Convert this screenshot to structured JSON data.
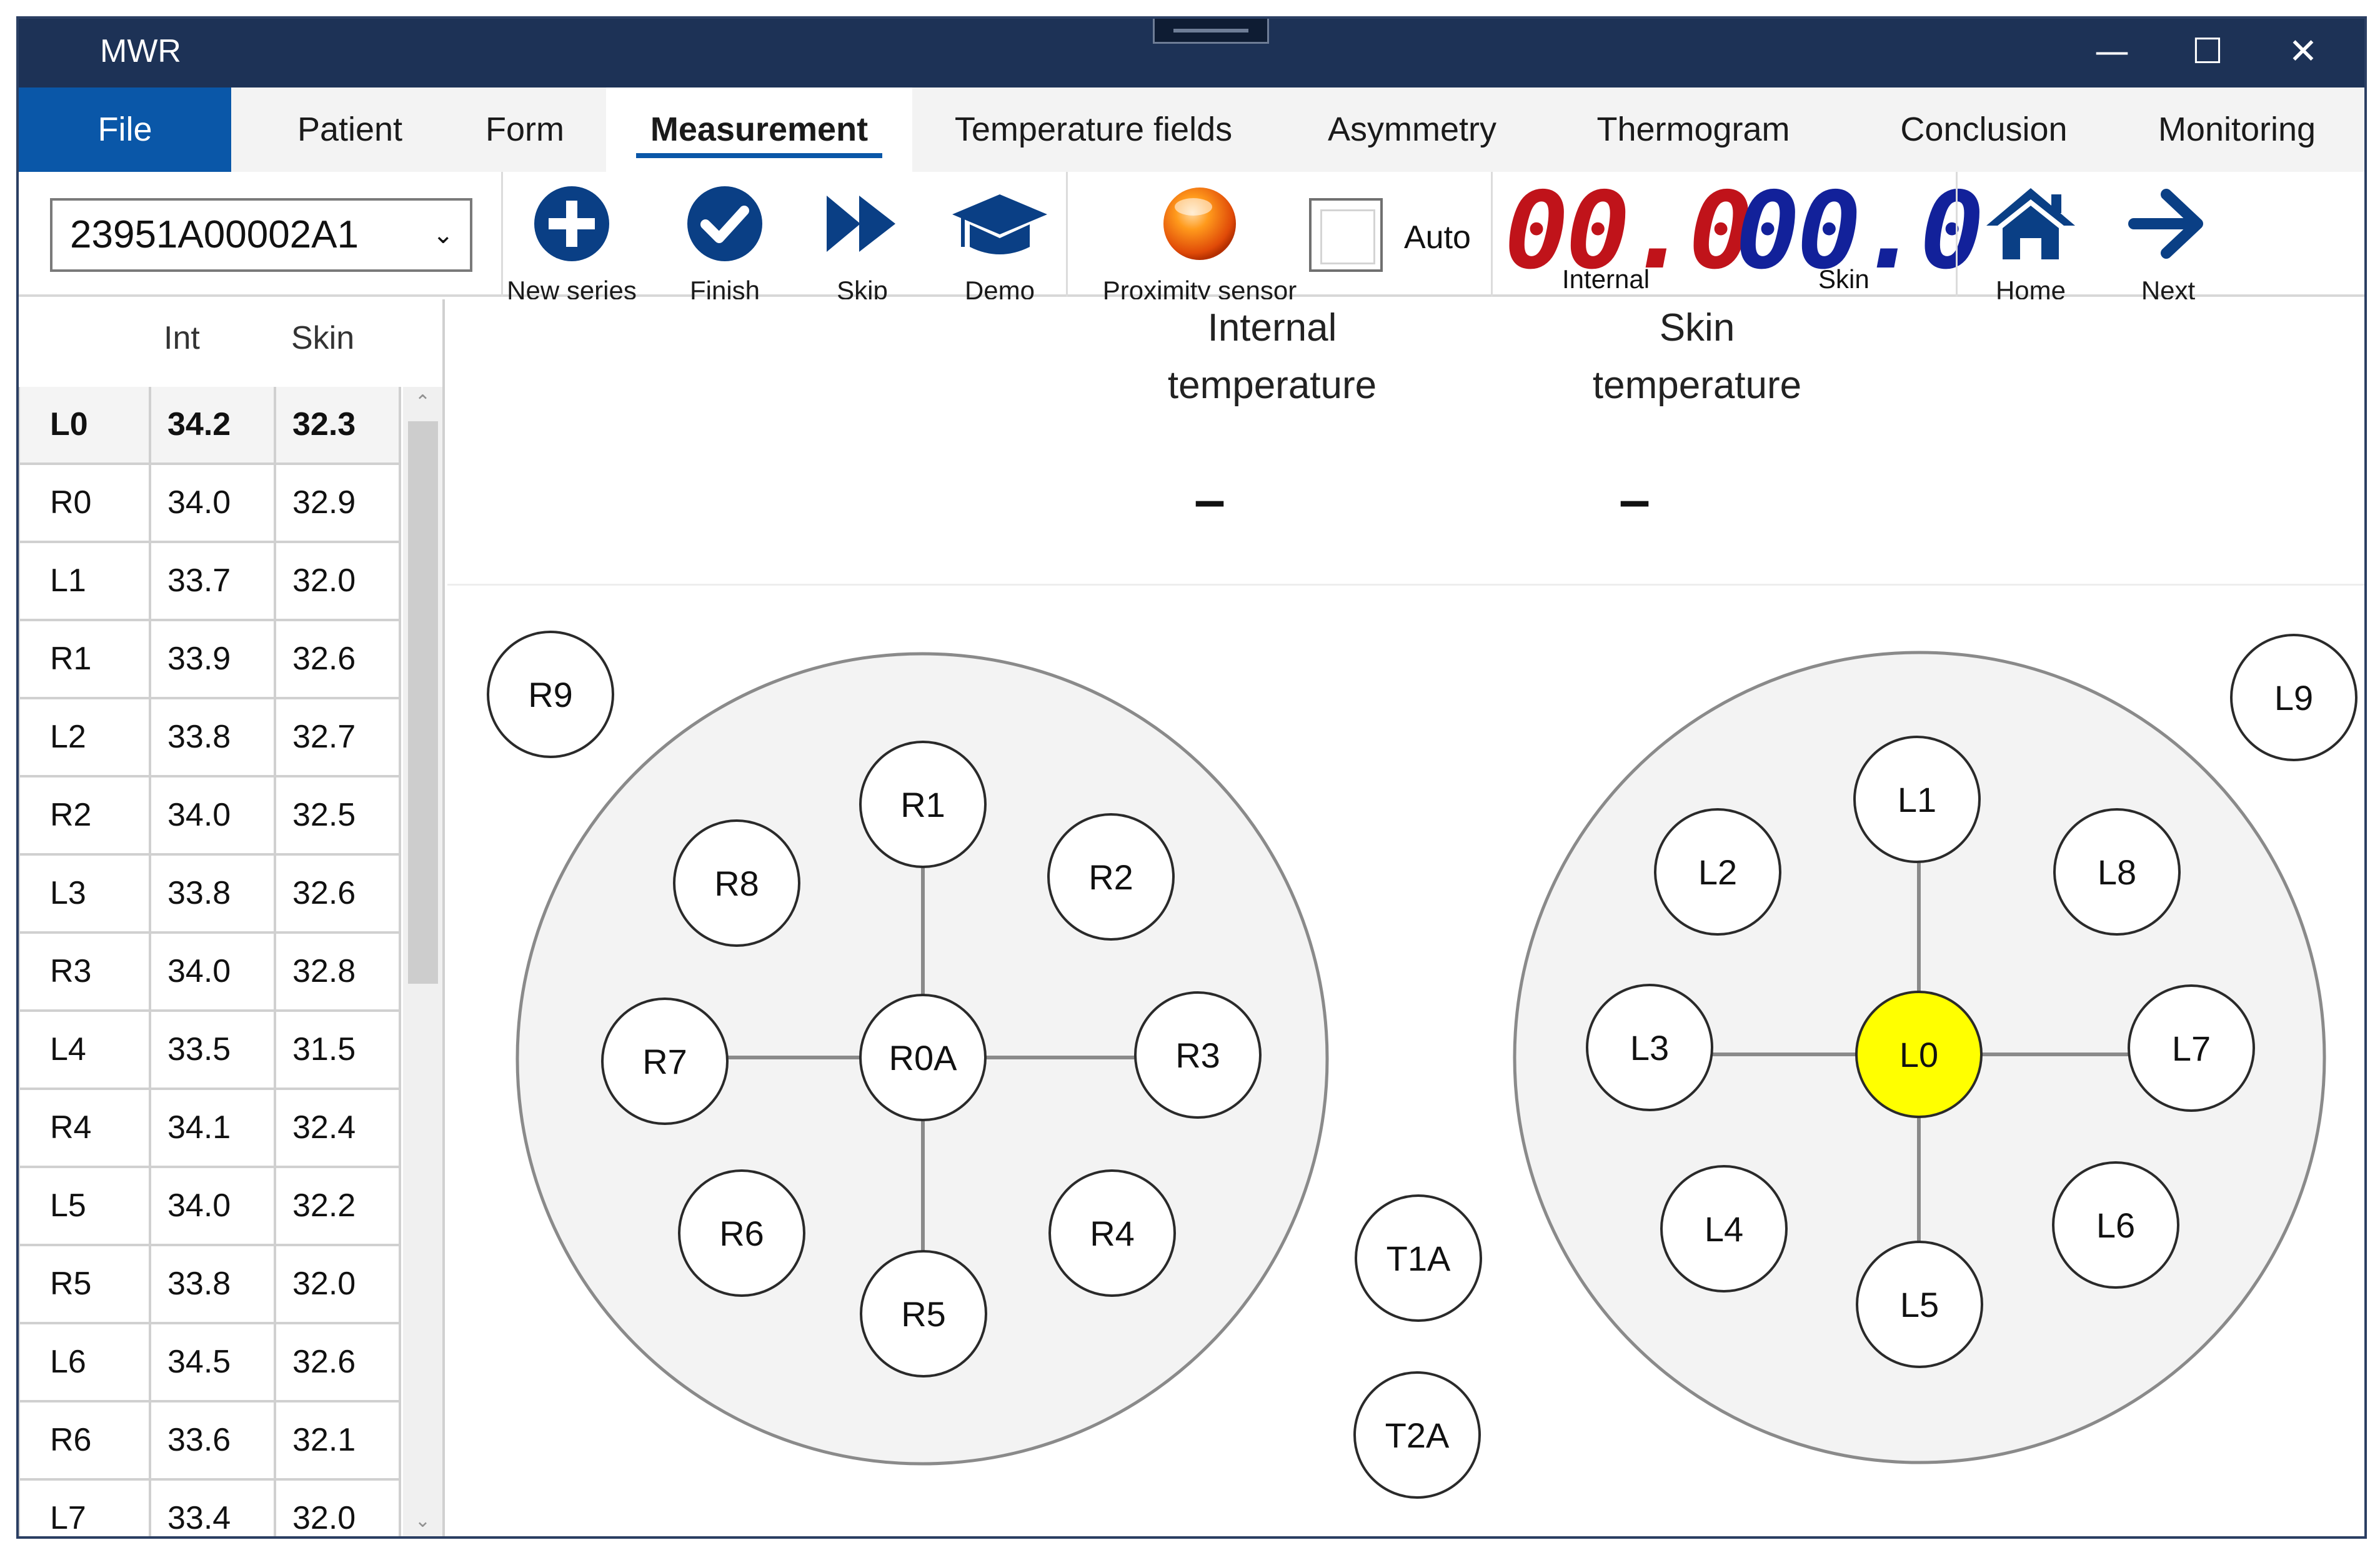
{
  "window": {
    "title": "MWR",
    "controls": {
      "minimize": "—",
      "maximize": "☐",
      "close": "✕"
    }
  },
  "menu": {
    "file": "File",
    "tabs": [
      "Patient",
      "Form",
      "Measurement",
      "Temperature fields",
      "Asymmetry",
      "Thermogram",
      "Conclusion",
      "Monitoring"
    ],
    "active_tab": "Measurement"
  },
  "toolbar": {
    "device_serial": "23951A00002A1",
    "new_series": "New series",
    "finish": "Finish",
    "skip": "Skip",
    "demo": "Demo",
    "proximity_sensor": "Proximity sensor",
    "auto_label": "Auto",
    "auto_checked": false,
    "internal_display": "00.0",
    "internal_label": "Internal",
    "skin_display": "00.0",
    "skin_label": "Skin",
    "home": "Home",
    "next": "Next",
    "colors": {
      "internal_digits": "#c0131a",
      "skin_digits": "#12219a",
      "icon_blue": "#0a3f85",
      "sensor_orange": "#f07a10"
    }
  },
  "table": {
    "col_int": "Int",
    "col_skin": "Skin",
    "selected": "L0",
    "rows": [
      {
        "point": "L0",
        "int": "34.2",
        "skin": "32.3"
      },
      {
        "point": "R0",
        "int": "34.0",
        "skin": "32.9"
      },
      {
        "point": "L1",
        "int": "33.7",
        "skin": "32.0"
      },
      {
        "point": "R1",
        "int": "33.9",
        "skin": "32.6"
      },
      {
        "point": "L2",
        "int": "33.8",
        "skin": "32.7"
      },
      {
        "point": "R2",
        "int": "34.0",
        "skin": "32.5"
      },
      {
        "point": "L3",
        "int": "33.8",
        "skin": "32.6"
      },
      {
        "point": "R3",
        "int": "34.0",
        "skin": "32.8"
      },
      {
        "point": "L4",
        "int": "33.5",
        "skin": "31.5"
      },
      {
        "point": "R4",
        "int": "34.1",
        "skin": "32.4"
      },
      {
        "point": "L5",
        "int": "34.0",
        "skin": "32.2"
      },
      {
        "point": "R5",
        "int": "33.8",
        "skin": "32.0"
      },
      {
        "point": "L6",
        "int": "34.5",
        "skin": "32.6"
      },
      {
        "point": "R6",
        "int": "33.6",
        "skin": "32.1"
      },
      {
        "point": "L7",
        "int": "33.4",
        "skin": "32.0"
      }
    ]
  },
  "readouts": {
    "internal_title": "Internal temperature",
    "internal_value": "–",
    "skin_title": "Skin temperature",
    "skin_value": "–"
  },
  "diagram": {
    "highlight_color": "#ffff00",
    "right_breast": {
      "center": "R0A",
      "points": [
        "R1",
        "R2",
        "R3",
        "R4",
        "R5",
        "R6",
        "R7",
        "R8"
      ],
      "outside": "R9"
    },
    "left_breast": {
      "center": "L0",
      "points": [
        "L1",
        "L2",
        "L3",
        "L4",
        "L5",
        "L6",
        "L7",
        "L8"
      ],
      "outside": "L9"
    },
    "extra": [
      "T1A",
      "T2A"
    ],
    "active_point": "L0"
  }
}
